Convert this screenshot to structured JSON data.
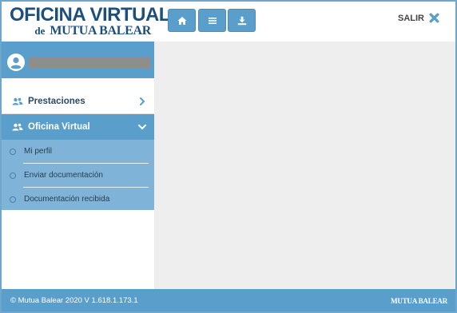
{
  "header": {
    "logo_top": "OFICINA VIRTUAL",
    "logo_de": "de",
    "logo_brand": "MUTUA BALEAR",
    "toolbar": {
      "home_icon": "home-icon",
      "menu_icon": "hamburger-menu-icon",
      "download_icon": "download-icon"
    },
    "salir_label": "SALIR",
    "salir_icon": "close-icon"
  },
  "sidebar": {
    "user_icon": "user-avatar-icon",
    "items": [
      {
        "label": "Prestaciones",
        "icon": "users-icon",
        "chevron": "chevron-right-icon"
      },
      {
        "label": "Oficina Virtual",
        "icon": "users-icon",
        "chevron": "chevron-down-icon"
      }
    ],
    "submenu": [
      {
        "label": "Mi perfil"
      },
      {
        "label": "Enviar documentación"
      },
      {
        "label": "Documentación recibida"
      }
    ]
  },
  "footer": {
    "copyright": "© Mutua Balear 2020 V 1.618.1.173.1",
    "brand": "MUTUA BALEAR"
  },
  "colors": {
    "primary": "#5a9fcb",
    "submenu_bg": "#7fb4d8",
    "logo_navy": "#1d4f7d",
    "logo_accent": "#e0407a",
    "content_bg": "#eeeeee",
    "username_redaction": "#8e8e8e"
  }
}
